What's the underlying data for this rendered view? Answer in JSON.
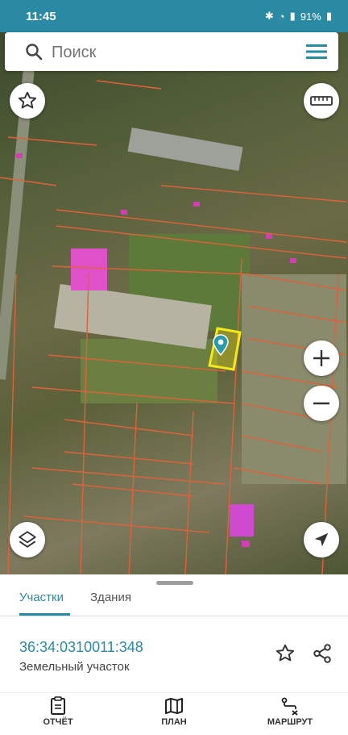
{
  "status_bar": {
    "time": "11:45",
    "battery": "91%"
  },
  "search": {
    "placeholder": "Поиск",
    "value": ""
  },
  "map": {
    "icons": [
      "star-icon",
      "ruler-icon",
      "zoom-in-icon",
      "zoom-out-icon",
      "layers-icon",
      "location-arrow-icon",
      "map-pin-icon"
    ]
  },
  "sheet": {
    "tabs": [
      {
        "label": "Участки"
      },
      {
        "label": "Здания"
      }
    ],
    "parcel": {
      "cadastral_number": "36:34:0310011:348",
      "type": "Земельный участок"
    }
  },
  "bottom_nav": {
    "items": [
      {
        "label": "ОТЧЁТ"
      },
      {
        "label": "ПЛАН"
      },
      {
        "label": "МАРШРУТ"
      }
    ]
  },
  "colors": {
    "accent": "#2a8aa4",
    "parcel_lines": "#e0623a",
    "selected_parcel": "#f2ea1a"
  }
}
